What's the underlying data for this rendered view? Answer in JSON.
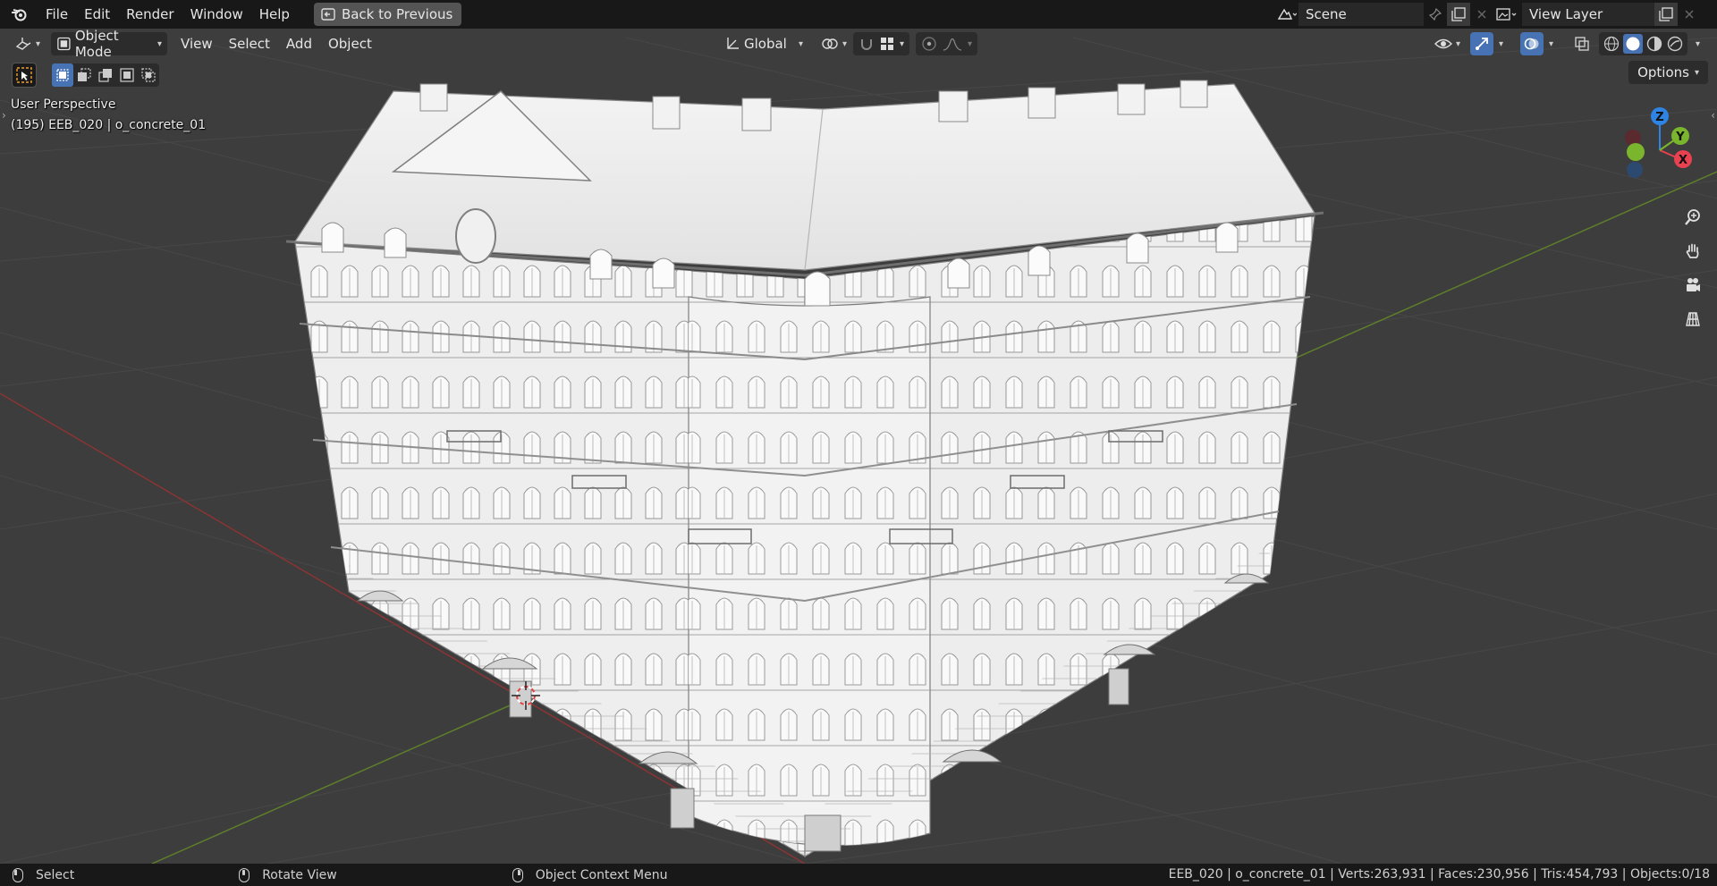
{
  "menu": {
    "items": [
      "File",
      "Edit",
      "Render",
      "Window",
      "Help"
    ],
    "back_button": "Back to Previous"
  },
  "scene": {
    "name": "Scene",
    "view_layer": "View Layer"
  },
  "viewport_header": {
    "mode": "Object Mode",
    "menus": [
      "View",
      "Select",
      "Add",
      "Object"
    ],
    "orientation": "Global",
    "options_label": "Options"
  },
  "overlay": {
    "perspective": "User Perspective",
    "object_info": "(195) EEB_020 | o_concrete_01"
  },
  "gizmo": {
    "z": "Z",
    "y": "Y",
    "x": "X"
  },
  "status": {
    "hints": [
      "Select",
      "Rotate View",
      "Object Context Menu"
    ],
    "stats": "EEB_020 | o_concrete_01 | Verts:263,931 | Faces:230,956 | Tris:454,793 | Objects:0/18"
  },
  "colors": {
    "accent": "#4772b3",
    "x_axis": "#e8414f",
    "y_axis": "#7bb52d",
    "z_axis": "#2f84e3",
    "viewport_bg": "#3d3d3d"
  },
  "icons": [
    "blender-logo",
    "back-icon",
    "scene-icon",
    "pin-icon",
    "new-icon",
    "close-icon",
    "view-layer-icon",
    "editor-type-icon",
    "object-mode-icon",
    "transform-orientation-icon",
    "pivot-icon",
    "snap-icon",
    "snap-grid-icon",
    "proportional-icon",
    "falloff-icon",
    "visibility-icon",
    "gizmo-icon",
    "overlay-icon",
    "xray-icon",
    "wireframe-shading-icon",
    "solid-shading-icon",
    "material-shading-icon",
    "rendered-shading-icon",
    "zoom-icon",
    "pan-hand-icon",
    "camera-icon",
    "grid-icon"
  ]
}
